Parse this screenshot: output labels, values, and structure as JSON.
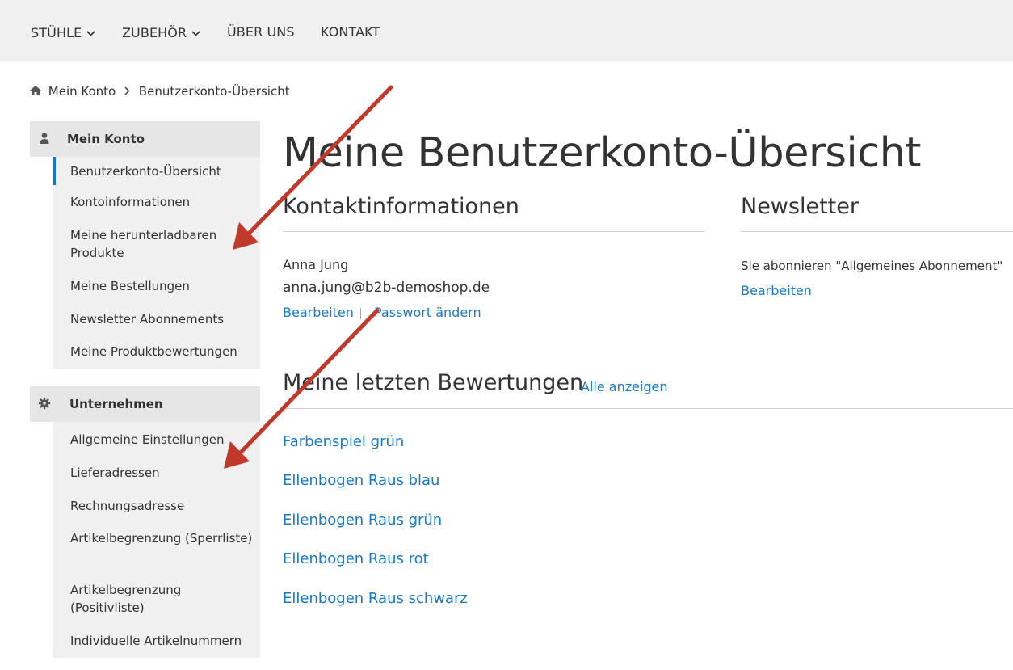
{
  "topnav": {
    "items": [
      {
        "label": "STÜHLE"
      },
      {
        "label": "ZUBEHÖR"
      },
      {
        "label": "ÜBER UNS"
      },
      {
        "label": "KONTAKT"
      }
    ]
  },
  "breadcrumb": {
    "home": "Mein Konto",
    "current": "Benutzerkonto-Übersicht"
  },
  "sidebar": {
    "account": {
      "heading": "Mein Konto",
      "items": [
        "Benutzerkonto-Übersicht",
        "Kontoinformationen",
        "Meine herunterladbaren Produkte",
        "Meine Bestellungen",
        "Newsletter Abonnements",
        "Meine Produktbewertungen"
      ]
    },
    "company": {
      "heading": "Unternehmen",
      "items": [
        "Allgemeine Einstellungen",
        "Lieferadressen",
        "Rechnungsadresse",
        "Artikelbegrenzung (Sperrliste)",
        "Artikelbegrenzung (Positivliste)",
        "Individuelle Artikelnummern"
      ]
    }
  },
  "main": {
    "title": "Meine Benutzerkonto-Übersicht",
    "contact": {
      "heading": "Kontaktinformationen",
      "name": "Anna Jung",
      "email": "anna.jung@b2b-demoshop.de",
      "edit_link": "Bearbeiten",
      "password_link": "Passwort ändern"
    },
    "newsletter": {
      "heading": "Newsletter",
      "status": "Sie abonnieren \"Allgemeines Abonnement\"",
      "edit_link": "Bearbeiten"
    },
    "reviews": {
      "heading": "Meine letzten Bewertungen",
      "view_all": "Alle anzeigen",
      "items": [
        "Farbenspiel grün",
        "Ellenbogen Raus blau",
        "Ellenbogen Raus grün",
        "Ellenbogen Raus rot",
        "Ellenbogen Raus schwarz"
      ]
    }
  },
  "colors": {
    "link": "#1979c3",
    "annotation_arrow": "#c0392b",
    "nav_bg": "#f0f0f0"
  }
}
